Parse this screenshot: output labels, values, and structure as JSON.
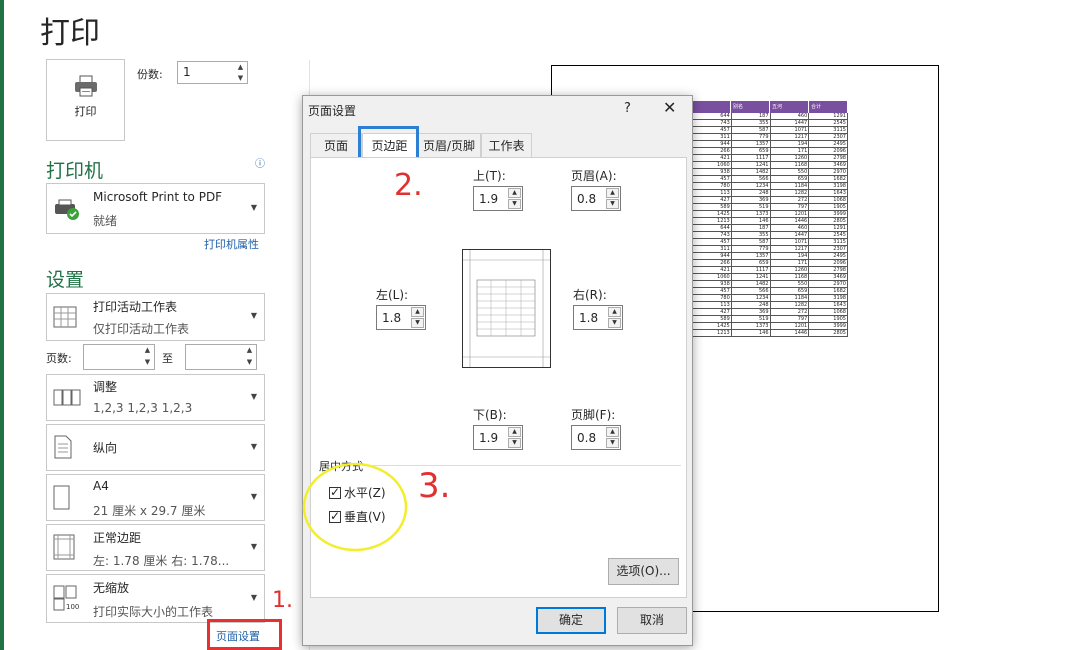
{
  "page": {
    "title": "打印"
  },
  "print": {
    "button_label": "打印",
    "copies_label": "份数:",
    "copies_value": "1"
  },
  "printer": {
    "section": "打印机",
    "name": "Microsoft Print to PDF",
    "status": "就绪",
    "properties_link": "打印机属性"
  },
  "settings": {
    "section": "设置",
    "what": {
      "t1": "打印活动工作表",
      "t2": "仅打印活动工作表"
    },
    "pages_label": "页数:",
    "pages_to": "至",
    "collate": {
      "t1": "调整",
      "t2": "1,2,3    1,2,3    1,2,3"
    },
    "orientation": {
      "t1": "纵向"
    },
    "paper": {
      "t1": "A4",
      "t2": "21 厘米 x 29.7 厘米"
    },
    "margins": {
      "t1": "正常边距",
      "t2": "左: 1.78 厘米    右: 1.78..."
    },
    "scaling": {
      "t1": "无缩放",
      "t2": "打印实际大小的工作表"
    },
    "page_setup_link": "页面设置"
  },
  "dialog": {
    "title": "页面设置",
    "help": "?",
    "close": "✕",
    "tabs": [
      "页面",
      "页边距",
      "页眉/页脚",
      "工作表"
    ],
    "top_label": "上(T):",
    "top_value": "1.9",
    "header_label": "页眉(A):",
    "header_value": "0.8",
    "left_label": "左(L):",
    "left_value": "1.8",
    "right_label": "右(R):",
    "right_value": "1.8",
    "bottom_label": "下(B):",
    "bottom_value": "1.9",
    "footer_label": "页脚(F):",
    "footer_value": "0.8",
    "center_group": "居中方式",
    "horizontal": "水平(Z)",
    "vertical": "垂直(V)",
    "options": "选项(O)...",
    "ok": "确定",
    "cancel": "取消"
  },
  "preview": {
    "headers": [
      "",
      "别名",
      "五河",
      "合计"
    ],
    "rows": [
      [
        "644",
        "187",
        "460",
        "1291"
      ],
      [
        "743",
        "355",
        "1447",
        "2545"
      ],
      [
        "457",
        "587",
        "1071",
        "3115"
      ],
      [
        "311",
        "779",
        "1217",
        "2307"
      ],
      [
        "944",
        "1357",
        "194",
        "2495"
      ],
      [
        "266",
        "659",
        "171",
        "2096"
      ],
      [
        "421",
        "1117",
        "1260",
        "2798"
      ],
      [
        "1060",
        "1241",
        "1168",
        "3469"
      ],
      [
        "938",
        "1482",
        "550",
        "2970"
      ],
      [
        "457",
        "566",
        "659",
        "1682"
      ],
      [
        "780",
        "1234",
        "1184",
        "3198"
      ],
      [
        "113",
        "248",
        "1282",
        "1643"
      ],
      [
        "427",
        "369",
        "272",
        "1068"
      ],
      [
        "589",
        "519",
        "797",
        "1905"
      ],
      [
        "1425",
        "1373",
        "1201",
        "3999"
      ],
      [
        "1213",
        "146",
        "1446",
        "2805"
      ],
      [
        "644",
        "187",
        "460",
        "1291"
      ],
      [
        "743",
        "355",
        "1447",
        "2545"
      ],
      [
        "457",
        "587",
        "1071",
        "3115"
      ],
      [
        "311",
        "779",
        "1217",
        "2307"
      ],
      [
        "944",
        "1357",
        "194",
        "2495"
      ],
      [
        "266",
        "659",
        "171",
        "2096"
      ],
      [
        "421",
        "1117",
        "1260",
        "2798"
      ],
      [
        "1060",
        "1241",
        "1168",
        "3469"
      ],
      [
        "938",
        "1482",
        "550",
        "2970"
      ],
      [
        "457",
        "566",
        "659",
        "1682"
      ],
      [
        "780",
        "1234",
        "1184",
        "3198"
      ],
      [
        "113",
        "248",
        "1282",
        "1643"
      ],
      [
        "427",
        "369",
        "272",
        "1068"
      ],
      [
        "589",
        "519",
        "797",
        "1905"
      ],
      [
        "1425",
        "1373",
        "1201",
        "3999"
      ],
      [
        "1213",
        "146",
        "1446",
        "2805"
      ]
    ]
  },
  "annotations": {
    "a1": "1.",
    "a2": "2.",
    "a3": "3."
  },
  "colors": {
    "accent": "#217346",
    "link": "#1e5fa8",
    "annotation_red": "#e03030",
    "annotation_blue": "#2d7fd4",
    "annotation_yellow": "#f2ee2e"
  }
}
